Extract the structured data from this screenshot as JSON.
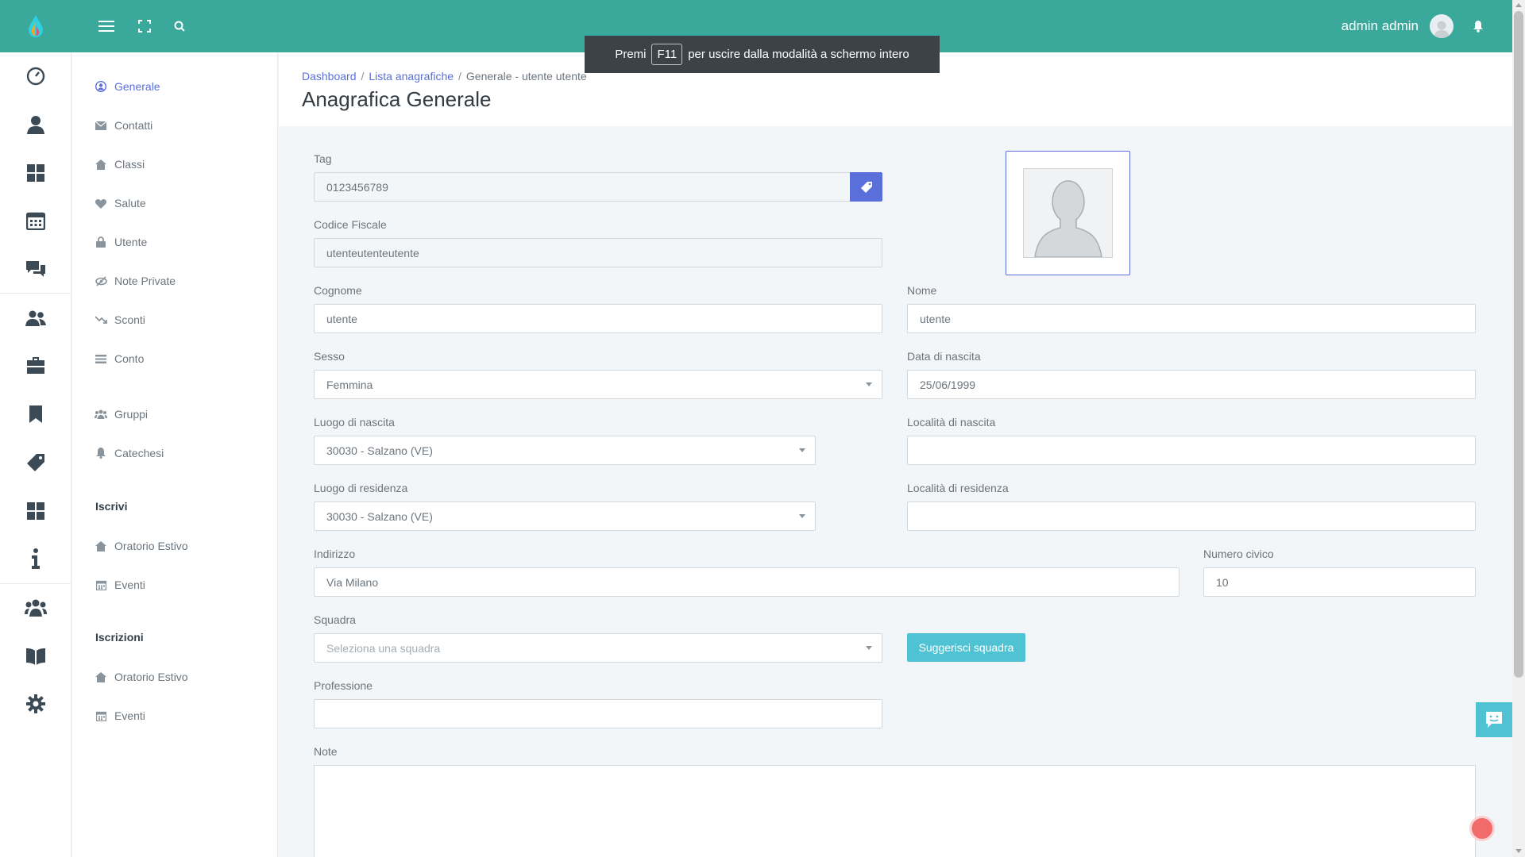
{
  "topbar": {
    "user_name": "admin admin",
    "icons": [
      "menu-icon",
      "fullscreen-icon",
      "search-icon",
      "bell-icon"
    ]
  },
  "fullscreen_notice": {
    "before": "Premi",
    "key": "F11",
    "after": "per uscire dalla modalità a schermo intero"
  },
  "rail": {
    "icons": [
      "dashboard-gauge-icon",
      "user-icon",
      "grid-icon",
      "calendar-icon",
      "chat-icon",
      "users-icon",
      "briefcase-icon",
      "bookmark-icon",
      "tag-icon",
      "apps-icon",
      "info-icon",
      "group-icon",
      "book-icon",
      "gear-icon"
    ]
  },
  "submenu": {
    "items": [
      {
        "label": "Generale",
        "icon": "user-circle-icon",
        "active": true
      },
      {
        "label": "Contatti",
        "icon": "envelope-icon"
      },
      {
        "label": "Classi",
        "icon": "home-icon"
      },
      {
        "label": "Salute",
        "icon": "heart-icon"
      },
      {
        "label": "Utente",
        "icon": "lock-icon"
      },
      {
        "label": "Note Private",
        "icon": "eye-slash-icon"
      },
      {
        "label": "Sconti",
        "icon": "trend-down-icon"
      },
      {
        "label": "Conto",
        "icon": "credit-card-icon"
      },
      {
        "label": "Gruppi",
        "icon": "users-icon"
      },
      {
        "label": "Catechesi",
        "icon": "bell-icon"
      }
    ],
    "section_iscrivi": {
      "title": "Iscrivi",
      "items": [
        {
          "label": "Oratorio Estivo",
          "icon": "home-icon"
        },
        {
          "label": "Eventi",
          "icon": "calendar-icon"
        }
      ]
    },
    "section_iscrizioni": {
      "title": "Iscrizioni",
      "items": [
        {
          "label": "Oratorio Estivo",
          "icon": "home-icon"
        },
        {
          "label": "Eventi",
          "icon": "calendar-icon"
        }
      ]
    }
  },
  "header": {
    "breadcrumb": [
      "Dashboard",
      "Lista anagrafiche",
      "Generale - utente utente"
    ],
    "title": "Anagrafica Generale"
  },
  "form": {
    "tag": {
      "label": "Tag",
      "value": "0123456789"
    },
    "codice_fiscale": {
      "label": "Codice Fiscale",
      "value": "utenteutenteutente"
    },
    "cognome": {
      "label": "Cognome",
      "value": "utente"
    },
    "nome": {
      "label": "Nome",
      "value": "utente"
    },
    "sesso": {
      "label": "Sesso",
      "value": "Femmina"
    },
    "data_nascita": {
      "label": "Data di nascita",
      "value": "25/06/1999"
    },
    "luogo_nascita": {
      "label": "Luogo di nascita",
      "value": "30030 - Salzano (VE)"
    },
    "localita_nascita": {
      "label": "Località di nascita",
      "value": ""
    },
    "luogo_residenza": {
      "label": "Luogo di residenza",
      "value": "30030 - Salzano (VE)"
    },
    "localita_residenza": {
      "label": "Località di residenza",
      "value": ""
    },
    "indirizzo": {
      "label": "Indirizzo",
      "value": "Via Milano"
    },
    "numero_civico": {
      "label": "Numero civico",
      "value": "10"
    },
    "squadra": {
      "label": "Squadra",
      "placeholder": "Seleziona una squadra"
    },
    "suggerisci_label": "Suggerisci squadra",
    "professione": {
      "label": "Professione",
      "value": ""
    },
    "note": {
      "label": "Note",
      "value": ""
    }
  },
  "colors": {
    "topbar": "#3aa99c",
    "accent": "#5b6fdb",
    "button_info": "#4fc3d3"
  }
}
